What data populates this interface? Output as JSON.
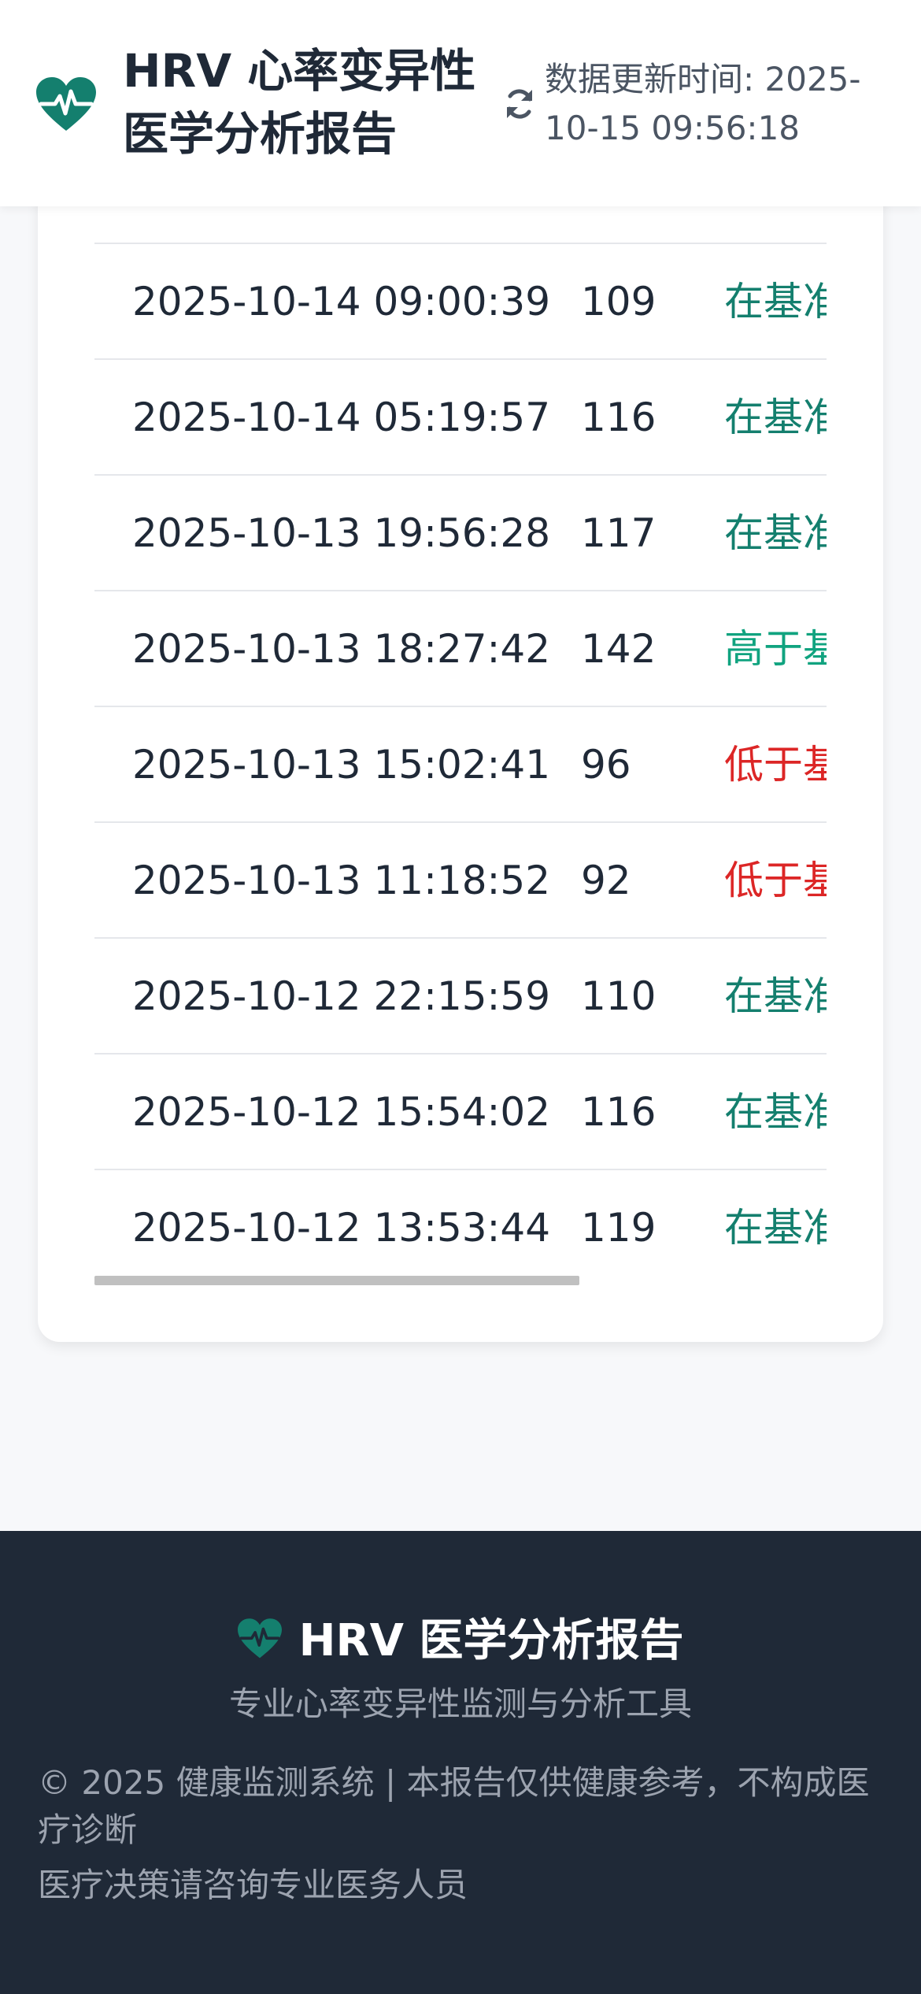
{
  "header": {
    "title": "HRV 心率变异性医学分析报告",
    "update_time": "数据更新时间: 2025-10-15 09:56:18",
    "logo_icon": "heart-pulse-icon",
    "refresh_icon": "refresh-icon"
  },
  "table": {
    "rows": [
      {
        "time": "2025-10-14 09:00:39",
        "value": "109",
        "status": "在基准",
        "status_color": "#147f6e"
      },
      {
        "time": "2025-10-14 05:19:57",
        "value": "116",
        "status": "在基准",
        "status_color": "#147f6e"
      },
      {
        "time": "2025-10-13 19:56:28",
        "value": "117",
        "status": "在基准",
        "status_color": "#147f6e"
      },
      {
        "time": "2025-10-13 18:27:42",
        "value": "142",
        "status": "高于基",
        "status_color": "#10a37f"
      },
      {
        "time": "2025-10-13 15:02:41",
        "value": "96",
        "status": "低于基",
        "status_color": "#dc2626"
      },
      {
        "time": "2025-10-13 11:18:52",
        "value": "92",
        "status": "低于基",
        "status_color": "#dc2626"
      },
      {
        "time": "2025-10-12 22:15:59",
        "value": "110",
        "status": "在基准",
        "status_color": "#147f6e"
      },
      {
        "time": "2025-10-12 15:54:02",
        "value": "116",
        "status": "在基准",
        "status_color": "#147f6e"
      },
      {
        "time": "2025-10-12 13:53:44",
        "value": "119",
        "status": "在基准",
        "status_color": "#147f6e"
      }
    ]
  },
  "footer": {
    "brand": "HRV 医学分析报告",
    "subtitle": "专业心率变异性监测与分析工具",
    "copyright": "© 2025 健康监测系统 | 本报告仅供健康参考，不构成医疗诊断",
    "note": "医疗决策请咨询专业医务人员"
  },
  "colors": {
    "brand": "#147f6e",
    "normal": "#147f6e",
    "high": "#10a37f",
    "low": "#dc2626",
    "footer_bg": "#1f2937"
  }
}
